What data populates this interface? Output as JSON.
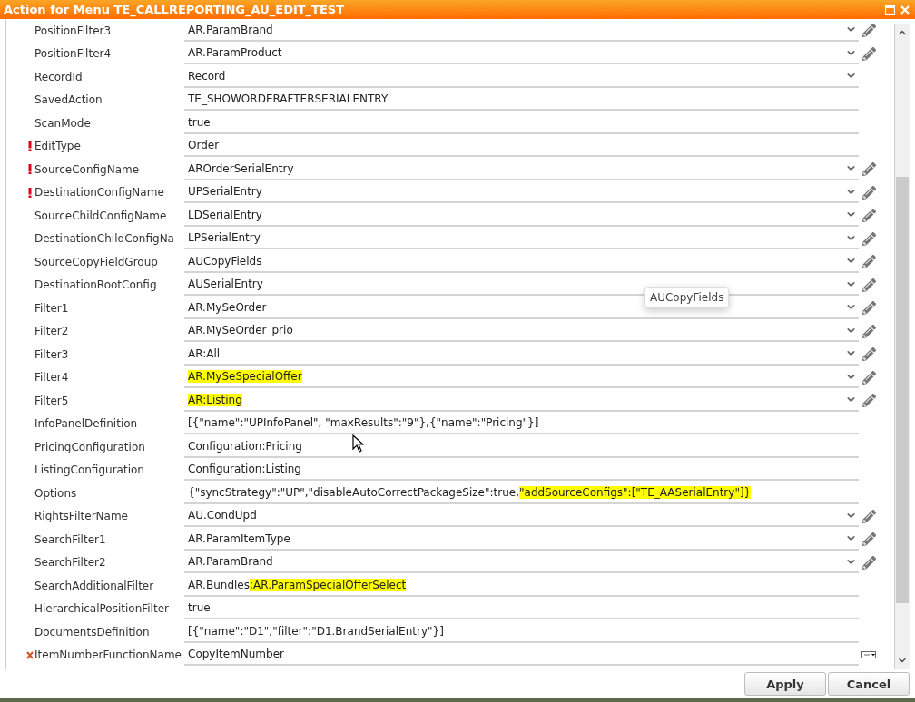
{
  "window": {
    "title": "Action for Menu TE_CALLREPORTING_AU_EDIT_TEST"
  },
  "rows": [
    {
      "label": "PositionFilter3",
      "required": false,
      "invalid": false,
      "value": [
        {
          "text": "AR.ParamBrand",
          "highlighted": false
        }
      ],
      "dropdown": true,
      "editable": true
    },
    {
      "label": "PositionFilter4",
      "required": false,
      "invalid": false,
      "value": [
        {
          "text": "AR.ParamProduct",
          "highlighted": false
        }
      ],
      "dropdown": true,
      "editable": true
    },
    {
      "label": "RecordId",
      "required": false,
      "invalid": false,
      "value": [
        {
          "text": "Record",
          "highlighted": false
        }
      ],
      "dropdown": true,
      "editable": false
    },
    {
      "label": "SavedAction",
      "required": false,
      "invalid": false,
      "value": [
        {
          "text": "TE_SHOWORDERAFTERSERIALENTRY",
          "highlighted": false
        }
      ],
      "dropdown": false,
      "editable": false
    },
    {
      "label": "ScanMode",
      "required": false,
      "invalid": false,
      "value": [
        {
          "text": "true",
          "highlighted": false
        }
      ],
      "dropdown": false,
      "editable": false
    },
    {
      "label": "EditType",
      "required": true,
      "invalid": false,
      "value": [
        {
          "text": "Order",
          "highlighted": false
        }
      ],
      "dropdown": false,
      "editable": false
    },
    {
      "label": "SourceConfigName",
      "required": true,
      "invalid": false,
      "value": [
        {
          "text": "AROrderSerialEntry",
          "highlighted": false
        }
      ],
      "dropdown": true,
      "editable": true
    },
    {
      "label": "DestinationConfigName",
      "required": true,
      "invalid": false,
      "value": [
        {
          "text": "UPSerialEntry",
          "highlighted": false
        }
      ],
      "dropdown": true,
      "editable": true
    },
    {
      "label": "SourceChildConfigName",
      "required": false,
      "invalid": false,
      "value": [
        {
          "text": "LDSerialEntry",
          "highlighted": false
        }
      ],
      "dropdown": true,
      "editable": true
    },
    {
      "label": "DestinationChildConfigNa",
      "required": false,
      "invalid": false,
      "value": [
        {
          "text": "LPSerialEntry",
          "highlighted": false
        }
      ],
      "dropdown": true,
      "editable": true
    },
    {
      "label": "SourceCopyFieldGroup",
      "required": false,
      "invalid": false,
      "value": [
        {
          "text": "AUCopyFields",
          "highlighted": false
        }
      ],
      "dropdown": true,
      "editable": true
    },
    {
      "label": "DestinationRootConfig",
      "required": false,
      "invalid": false,
      "value": [
        {
          "text": "AUSerialEntry",
          "highlighted": false
        }
      ],
      "dropdown": true,
      "editable": true
    },
    {
      "label": "Filter1",
      "required": false,
      "invalid": false,
      "value": [
        {
          "text": "AR.MySeOrder",
          "highlighted": false
        }
      ],
      "dropdown": true,
      "editable": true
    },
    {
      "label": "Filter2",
      "required": false,
      "invalid": false,
      "value": [
        {
          "text": "AR.MySeOrder_prio",
          "highlighted": false
        }
      ],
      "dropdown": true,
      "editable": true
    },
    {
      "label": "Filter3",
      "required": false,
      "invalid": false,
      "value": [
        {
          "text": "AR:All",
          "highlighted": false
        }
      ],
      "dropdown": true,
      "editable": true
    },
    {
      "label": "Filter4",
      "required": false,
      "invalid": false,
      "value": [
        {
          "text": "AR.MySeSpecialOffer",
          "highlighted": true
        }
      ],
      "dropdown": true,
      "editable": true
    },
    {
      "label": "Filter5",
      "required": false,
      "invalid": false,
      "value": [
        {
          "text": "AR:Listing",
          "highlighted": true
        }
      ],
      "dropdown": true,
      "editable": true
    },
    {
      "label": "InfoPanelDefinition",
      "required": false,
      "invalid": false,
      "value": [
        {
          "text": "[{\"name\":\"UPInfoPanel\", \"maxResults\":\"9\"},{\"name\":\"Pricing\"}]",
          "highlighted": false
        }
      ],
      "dropdown": false,
      "editable": false
    },
    {
      "label": "PricingConfiguration",
      "required": false,
      "invalid": false,
      "value": [
        {
          "text": "Configuration:Pricing",
          "highlighted": false
        }
      ],
      "dropdown": false,
      "editable": false
    },
    {
      "label": "ListingConfiguration",
      "required": false,
      "invalid": false,
      "value": [
        {
          "text": "Configuration:Listing",
          "highlighted": false
        }
      ],
      "dropdown": false,
      "editable": false
    },
    {
      "label": "Options",
      "required": false,
      "invalid": false,
      "value": [
        {
          "text": "{\"syncStrategy\":\"UP\",\"disableAutoCorrectPackageSize\":true,",
          "highlighted": false
        },
        {
          "text": "\"addSourceConfigs\":[\"TE_AASerialEntry\"]}",
          "highlighted": true
        }
      ],
      "dropdown": false,
      "editable": false
    },
    {
      "label": "RightsFilterName",
      "required": false,
      "invalid": false,
      "value": [
        {
          "text": "AU.CondUpd",
          "highlighted": false
        }
      ],
      "dropdown": true,
      "editable": true
    },
    {
      "label": "SearchFilter1",
      "required": false,
      "invalid": false,
      "value": [
        {
          "text": "AR.ParamItemType",
          "highlighted": false
        }
      ],
      "dropdown": true,
      "editable": true
    },
    {
      "label": "SearchFilter2",
      "required": false,
      "invalid": false,
      "value": [
        {
          "text": "AR.ParamBrand",
          "highlighted": false
        }
      ],
      "dropdown": true,
      "editable": true
    },
    {
      "label": "SearchAdditionalFilter",
      "required": false,
      "invalid": false,
      "value": [
        {
          "text": "AR.Bundles",
          "highlighted": false
        },
        {
          "text": ";AR.ParamSpecialOfferSelect",
          "highlighted": true
        }
      ],
      "dropdown": false,
      "editable": false
    },
    {
      "label": "HierarchicalPositionFilter",
      "required": false,
      "invalid": false,
      "value": [
        {
          "text": "true",
          "highlighted": false
        }
      ],
      "dropdown": false,
      "editable": false
    },
    {
      "label": "DocumentsDefinition",
      "required": false,
      "invalid": false,
      "value": [
        {
          "text": "[{\"name\":\"D1\",\"filter\":\"D1.BrandSerialEntry\"}]",
          "highlighted": false
        }
      ],
      "dropdown": false,
      "editable": false
    },
    {
      "label": "ItemNumberFunctionName",
      "required": false,
      "invalid": true,
      "value": [
        {
          "text": "CopyItemNumber",
          "highlighted": false
        }
      ],
      "dropdown": false,
      "editable": false,
      "picker": true
    }
  ],
  "tooltip": {
    "text": "AUCopyFields"
  },
  "buttons": [
    {
      "label": "Apply"
    },
    {
      "label": "Cancel"
    }
  ]
}
